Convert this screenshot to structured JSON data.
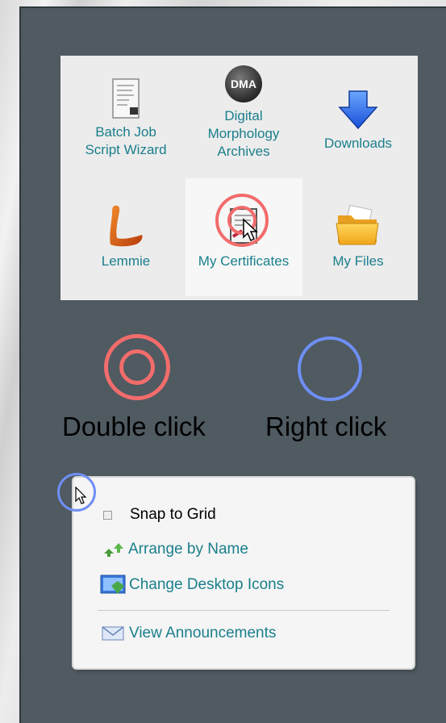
{
  "desktop": {
    "icons": [
      {
        "label": "Batch Job Script Wizard",
        "icon": "script-document-icon"
      },
      {
        "label": "Digital Morphology Archives",
        "badge": "DMA",
        "icon": "dma-disc-icon"
      },
      {
        "label": "Downloads",
        "icon": "download-arrow-icon"
      },
      {
        "label": "Lemmie",
        "icon": "lemmie-logo-icon"
      },
      {
        "label": "My Certificates",
        "icon": "certificate-icon"
      },
      {
        "label": "My Files",
        "icon": "folder-icon"
      }
    ]
  },
  "legend": {
    "double_click": "Double click",
    "right_click": "Right click"
  },
  "context_menu": {
    "items": [
      {
        "label": "Snap to Grid",
        "icon": "checkbox-icon",
        "checked": false
      },
      {
        "label": "Arrange by Name",
        "icon": "arrange-arrows-icon"
      },
      {
        "label": "Change Desktop Icons",
        "icon": "desktop-icons-icon"
      },
      {
        "label": "View Announcements",
        "icon": "envelope-icon"
      }
    ]
  },
  "colors": {
    "panel": "#4f5a61",
    "link": "#1a7f8c",
    "double_click_ring": "#f26c6c",
    "right_click_ring": "#6f8ff5"
  }
}
